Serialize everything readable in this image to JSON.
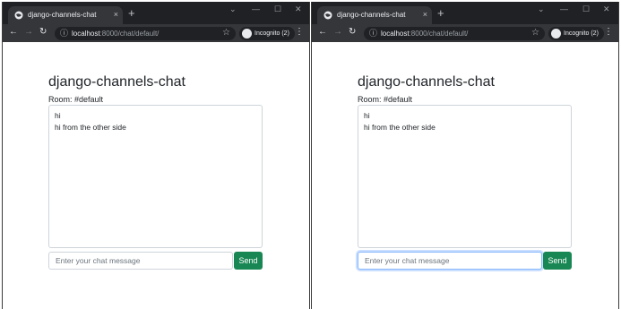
{
  "windows": [
    {
      "tab": {
        "title": "django-channels-chat"
      },
      "address": {
        "host": "localhost",
        "rest": ":8000/chat/default/"
      },
      "incognito_label": "Incognito (2)",
      "page": {
        "heading": "django-channels-chat",
        "room": "Room: #default",
        "messages": [
          "hi",
          "hi from the other side"
        ],
        "input_placeholder": "Enter your chat message",
        "send_label": "Send",
        "input_focused": false
      }
    },
    {
      "tab": {
        "title": "django-channels-chat"
      },
      "address": {
        "host": "localhost",
        "rest": ":8000/chat/default/"
      },
      "incognito_label": "Incognito (2)",
      "page": {
        "heading": "django-channels-chat",
        "room": "Room: #default",
        "messages": [
          "hi",
          "hi from the other side"
        ],
        "input_placeholder": "Enter your chat message",
        "send_label": "Send",
        "input_focused": true
      }
    }
  ],
  "icons": {
    "tab_close": "×",
    "new_tab": "+",
    "back": "←",
    "forward": "→",
    "reload": "↻",
    "info": "ⓘ",
    "star": "☆",
    "menu": "⋮",
    "minimize": "—",
    "maximize": "☐",
    "window_close": "✕",
    "chevron": "⌄"
  },
  "colors": {
    "send_button": "#198754",
    "focus_ring": "#86b7fe",
    "titlebar": "#202124",
    "toolbar": "#35363a"
  }
}
